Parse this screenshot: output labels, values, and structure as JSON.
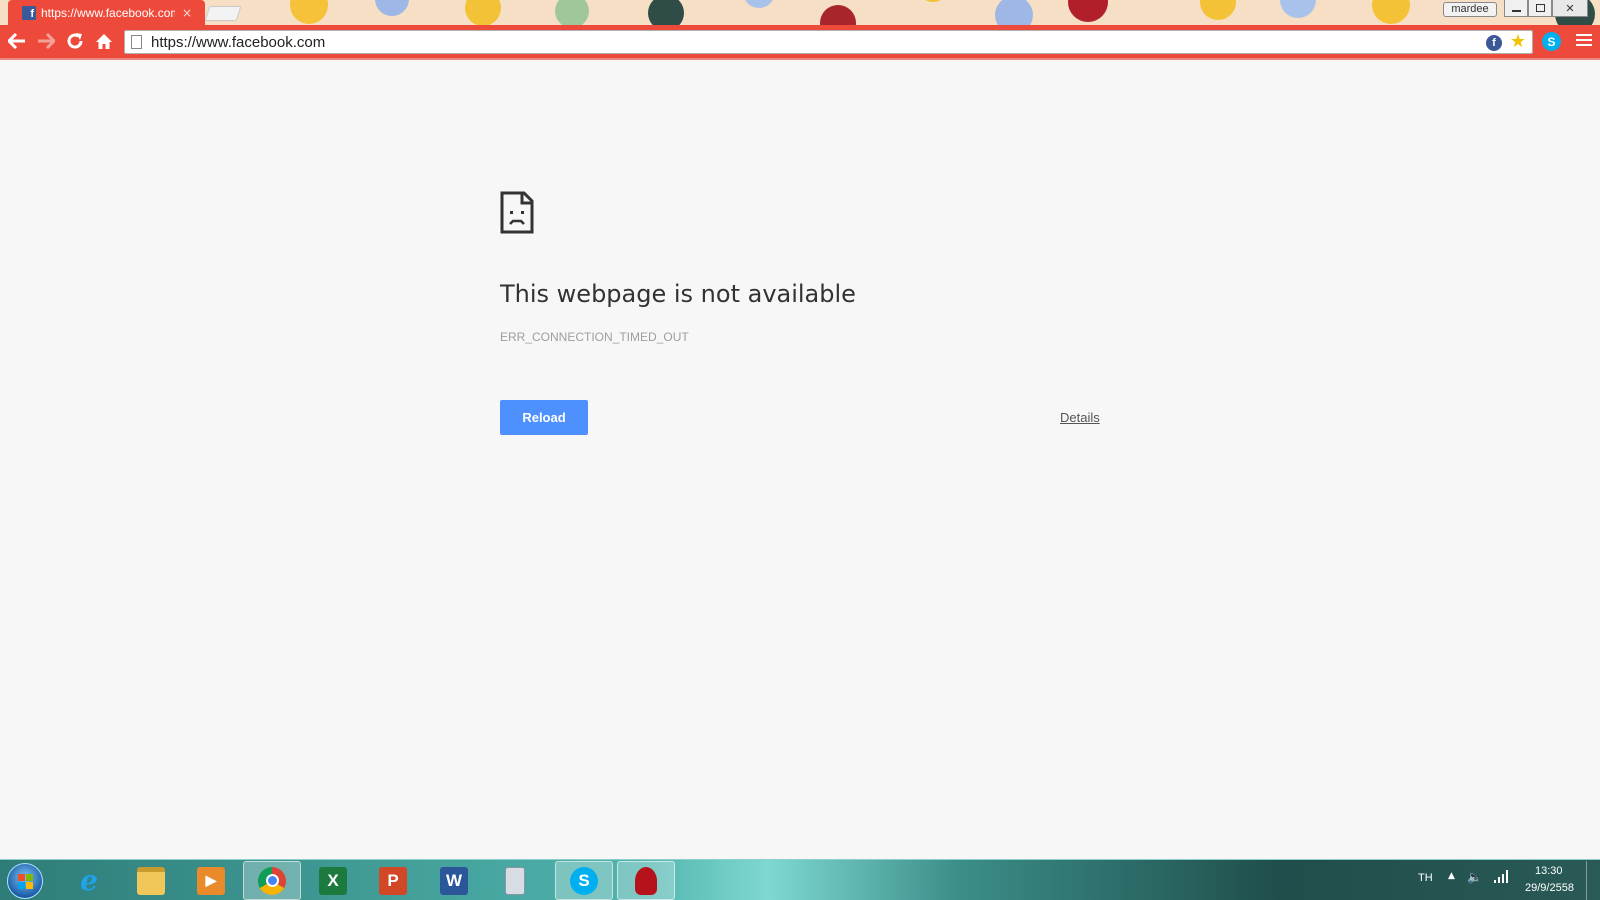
{
  "browser": {
    "tab": {
      "title": "https://www.facebook.com",
      "favicon": "facebook-favicon",
      "close_glyph": "×"
    },
    "profile_name": "mardee",
    "window_controls": [
      "minimize-icon",
      "restore-icon",
      "close-icon"
    ],
    "omnibox": {
      "url": "https://www.facebook.com"
    },
    "toolbar_icons": [
      "back-arrow-icon",
      "forward-arrow-icon",
      "reload-icon",
      "home-icon"
    ],
    "extension_icons": [
      "facebook-extension-icon",
      "bookmark-star-icon",
      "skype-extension-icon",
      "menu-icon"
    ],
    "colors": {
      "theme_red": "#ee4a3c",
      "omnibox_bg": "#ffffff"
    }
  },
  "error_page": {
    "title": "This webpage is not available",
    "code": "ERR_CONNECTION_TIMED_OUT",
    "reload_label": "Reload",
    "details_label": "Details",
    "icon": "sad-page-icon",
    "colors": {
      "button_blue": "#4d90fe"
    }
  },
  "taskbar": {
    "apps": [
      {
        "name": "internet-explorer-icon",
        "glyph": "e"
      },
      {
        "name": "file-explorer-icon",
        "glyph": ""
      },
      {
        "name": "media-player-icon",
        "glyph": "▶"
      },
      {
        "name": "chrome-icon",
        "glyph": "",
        "active": true
      },
      {
        "name": "excel-icon",
        "glyph": "X"
      },
      {
        "name": "powerpoint-icon",
        "glyph": "P"
      },
      {
        "name": "word-icon",
        "glyph": "W"
      },
      {
        "name": "calculator-icon",
        "glyph": ""
      },
      {
        "name": "skype-icon",
        "glyph": "S",
        "active": true
      },
      {
        "name": "red-app-icon",
        "glyph": "",
        "active": true
      }
    ],
    "tray": {
      "language": "TH",
      "time": "13:30",
      "date": "29/9/2558"
    }
  }
}
